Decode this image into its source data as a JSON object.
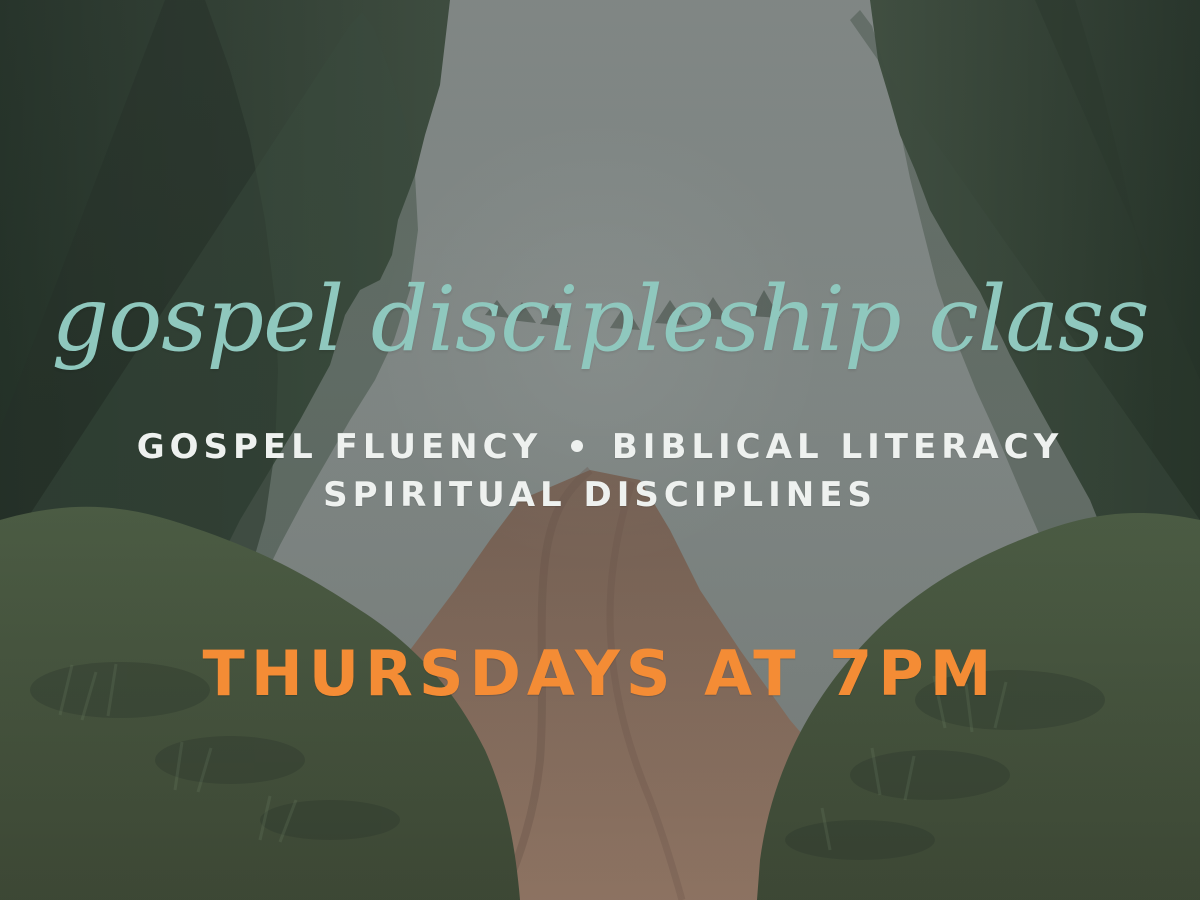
{
  "poster": {
    "title": "gospel discipleship class",
    "subtitle_line1_left": "GOSPEL FLUENCY",
    "subtitle_separator": "•",
    "subtitle_line1_right": "BIBLICAL LITERACY",
    "subtitle_line2": "SPIRITUAL DISCIPLINES",
    "schedule": "THURSDAYS AT 7PM"
  },
  "colors": {
    "title": "#8fc8be",
    "subtitle": "#eef1ef",
    "schedule": "#f48c35",
    "sky": "#8e9594",
    "forest": "#3f5144",
    "road": "#8a6d5d"
  }
}
